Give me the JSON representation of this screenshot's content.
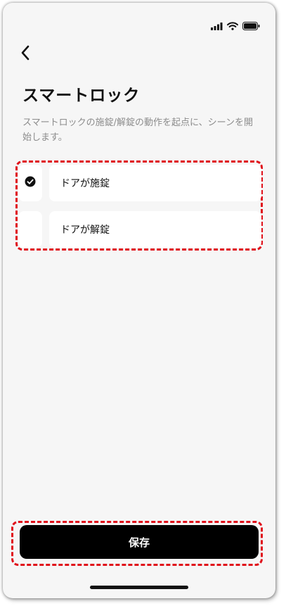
{
  "status_bar": {
    "signal_icon": "cellular-signal-icon",
    "wifi_icon": "wifi-icon",
    "battery_icon": "battery-icon"
  },
  "header": {
    "back_icon": "chevron-left-icon",
    "title": "スマートロック"
  },
  "description": "スマートロックの施錠/解錠の動作を起点に、シーンを開始します。",
  "options": [
    {
      "label": "ドアが施錠",
      "selected": true
    },
    {
      "label": "ドアが解錠",
      "selected": false
    }
  ],
  "footer": {
    "save_label": "保存"
  },
  "colors": {
    "background": "#f6f6f6",
    "card": "#ffffff",
    "primary": "#000000",
    "highlight": "#e0101a",
    "muted_text": "#8c8c8c"
  }
}
